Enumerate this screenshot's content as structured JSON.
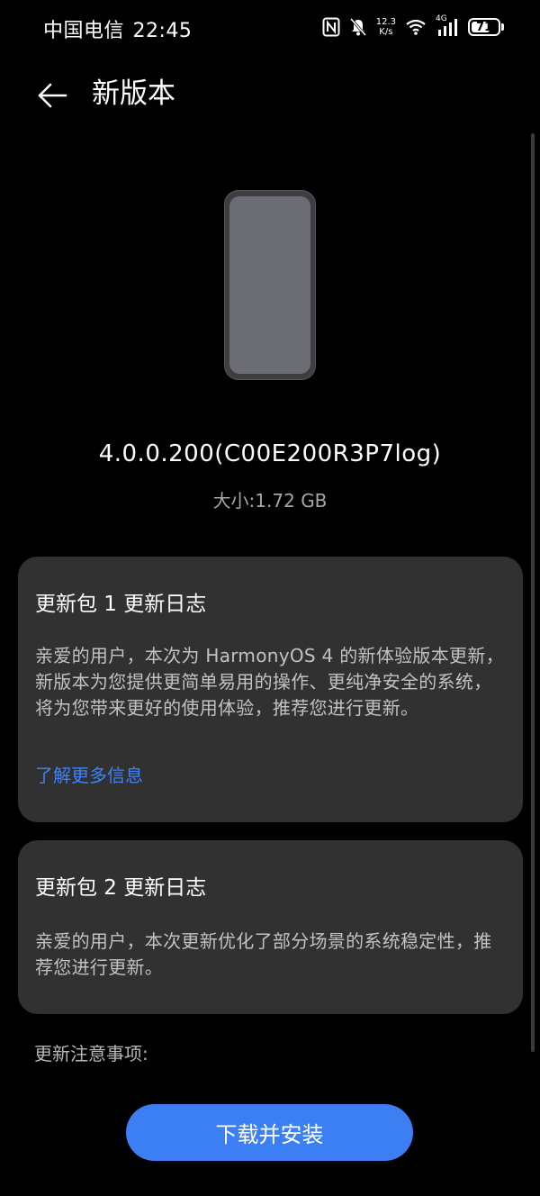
{
  "status_bar": {
    "carrier": "中国电信",
    "time": "22:45",
    "net_speed_value": "12.3",
    "net_speed_unit": "K/s",
    "network_type": "4G",
    "battery_level": "71",
    "battery_percent": 71,
    "icons": [
      "nfc-icon",
      "mute-bell-icon",
      "wifi-icon",
      "signal-icon",
      "battery-icon"
    ]
  },
  "header": {
    "title": "新版本"
  },
  "update": {
    "version": "4.0.0.200(C00E200R3P7log)",
    "size": "大小:1.72 GB"
  },
  "changelogs": [
    {
      "title": "更新包 1 更新日志",
      "body": "亲爱的用户，本次为 HarmonyOS 4 的新体验版本更新，新版本为您提供更简单易用的操作、更纯净安全的系统，将为您带来更好的使用体验，推荐您进行更新。",
      "link": "了解更多信息"
    },
    {
      "title": "更新包 2 更新日志",
      "body": "亲爱的用户，本次更新优化了部分场景的系统稳定性，推荐您进行更新。"
    }
  ],
  "notes_label": "更新注意事项:",
  "actions": {
    "install_label": "下载并安装"
  },
  "colors": {
    "background": "#000000",
    "card": "#313131",
    "accent": "#3b7ff2",
    "link": "#3c82ff"
  }
}
